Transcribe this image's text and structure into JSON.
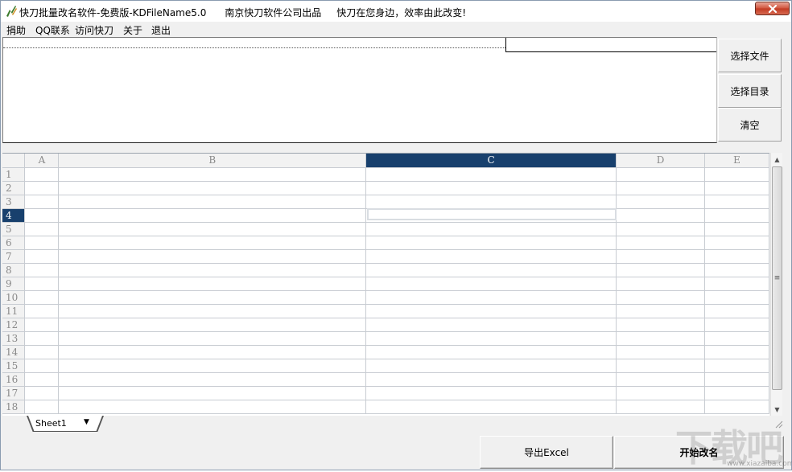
{
  "window": {
    "title": "快刀批量改名软件-免费版-KDFileName5.0      南京快刀软件公司出品     快刀在您身边，效率由此改变!",
    "close_symbol": "✕"
  },
  "menu": {
    "items": [
      "捐助",
      "QQ联系",
      "访问快刀",
      "关于",
      "退出"
    ]
  },
  "side_buttons": {
    "select_file": "选择文件",
    "select_dir": "选择目录",
    "clear": "清空"
  },
  "grid": {
    "columns": [
      "A",
      "B",
      "C",
      "D",
      "E"
    ],
    "selected_column": "C",
    "rows": [
      "1",
      "2",
      "3",
      "4",
      "5",
      "6",
      "7",
      "8",
      "9",
      "10",
      "11",
      "12",
      "13",
      "14",
      "15",
      "16",
      "17",
      "18"
    ],
    "selected_row": "4"
  },
  "sheet": {
    "tab_label": "Sheet1",
    "dropdown_symbol": "▼"
  },
  "scrollbar": {
    "up_symbol": "▲",
    "down_symbol": "▼",
    "thumb_grip": "≡"
  },
  "bottom_buttons": {
    "export_excel": "导出Excel",
    "start_rename": "开始改名"
  },
  "watermark": {
    "text": "下载吧",
    "url": "www.xiazaiba.com"
  }
}
